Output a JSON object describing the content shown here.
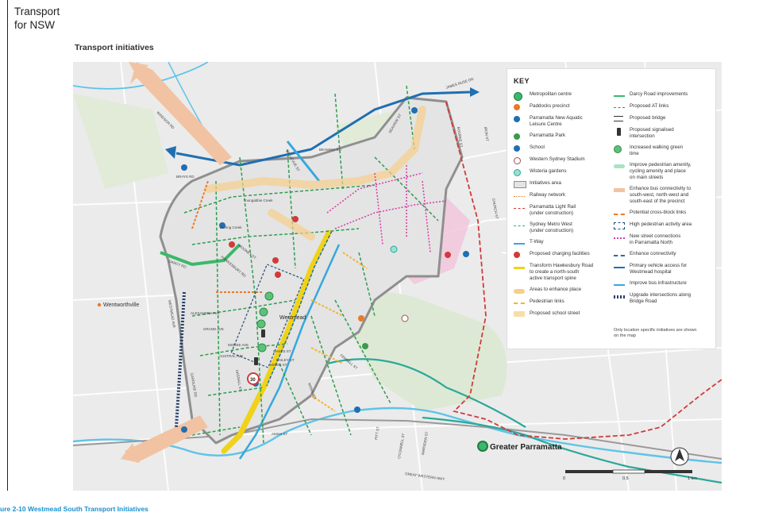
{
  "header": {
    "logo_text": "Transport\nfor NSW",
    "section_title": "Transport initiatives"
  },
  "caption": "ure 2-10 Westmead South Transport Initiatives",
  "map": {
    "places": {
      "westmead": "Westmead",
      "wentworthville": "Wentworthville",
      "greater_parramatta": "Greater Parramatta"
    },
    "speed_sign": "30",
    "streets": {
      "windsor_rd": "WINDSOR RD",
      "james_ruse_dr": "JAMES RUSE DR",
      "bourke_st": "BOURKE ST",
      "iron_st": "IRON ST",
      "brays_rd": "BRAYS RD",
      "church_st": "CHURCH ST",
      "bellevue_st": "BELLEVUE ST",
      "seaview_st": "SEAVIEW ST",
      "caroline_rd": "CAROLINE RD",
      "beamish_rd": "BEAMISH RD",
      "toongabbie_creek": "Toongabbie Creek",
      "darling_creek": "Darling Creek",
      "darcy_rd": "DARCY RD",
      "hawkesbury_rd": "HAWKESBURY RD",
      "westmead_ave": "WESTMEAD AVE",
      "alexandra_ave": "ALEXANDRA AVE",
      "grand_ave": "GRAND AVE",
      "moree_ave": "MOREE AVE",
      "austral_ave": "AUSTRAL AVE",
      "hassall_st": "HASSALL ST",
      "bailey_st": "BAILEY ST",
      "oakes_st": "OAKES ST",
      "moxie_st": "MOXIE ST",
      "amos_st": "AMOS ST",
      "pitt_st": "PITT ST",
      "oconnell_st": "O'CONNELL ST",
      "marsden_st": "MARSDEN ST",
      "great_western_hwy": "GREAT WESTERN HWY",
      "fennell_st": "FENNELL ST",
      "mons_rd": "MONS RD",
      "mooney_st": "MOONEY ST"
    },
    "scale_bar": {
      "ticks": [
        "0",
        "0.5",
        "1 km"
      ]
    },
    "colors": {
      "darcy_road": "#3bb86a",
      "at_links": "#2e9d4e",
      "light_rail": "#d23a3a",
      "metro": "#2aa89b",
      "tway": "#36a8dd",
      "hawkesbury_spine": "#f0d21a",
      "ped_links": "#f2b632",
      "place_areas": "#f7cf8b",
      "bus_connectivity": "#f2c3a2",
      "vehicle_access": "#1f6fb2",
      "new_street": "#d63aa7",
      "parramatta_north": "#f2c6dc",
      "initiatives_area_border": "#8f8f8f"
    }
  },
  "key": {
    "title": "KEY",
    "left": [
      {
        "label": "Metropolitan centre",
        "icon": "metropolitan-centre-icon"
      },
      {
        "label": "Paddocks precinct",
        "icon": "paddocks-icon"
      },
      {
        "label": "Parramatta New Aquatic\nLeisure Centre",
        "icon": "aquatic-centre-icon"
      },
      {
        "label": "Parramatta Park",
        "icon": "park-icon"
      },
      {
        "label": "School",
        "icon": "school-icon"
      },
      {
        "label": "Western Sydney Stadium",
        "icon": "stadium-icon"
      },
      {
        "label": "Wisteria gardens",
        "icon": "gardens-icon"
      },
      {
        "label": "Initiatives area",
        "icon": "initiatives-area-icon"
      },
      {
        "label": "Railway network",
        "icon": "railway-icon"
      },
      {
        "label": "Parramatta Light Rail\n(under construction)",
        "icon": "light-rail-icon"
      },
      {
        "label": "Sydney Metro West\n(under construction)",
        "icon": "metro-icon"
      },
      {
        "label": "T-Way",
        "icon": "tway-icon"
      },
      {
        "label": "Proposed charging facilities",
        "icon": "charging-icon"
      },
      {
        "label": "Transform Hawkesbury Road\nto create a north-south\nactive transport spine",
        "icon": "hawkesbury-spine-icon"
      },
      {
        "label": "Areas to enhance place",
        "icon": "enhance-place-icon"
      },
      {
        "label": "Pedestrian links",
        "icon": "pedestrian-links-icon"
      },
      {
        "label": "Proposed school street",
        "icon": "school-street-icon"
      }
    ],
    "right": [
      {
        "label": "Darcy Road improvements",
        "icon": "darcy-road-icon"
      },
      {
        "label": "Proposed AT links",
        "icon": "at-links-icon"
      },
      {
        "label": "Proposed bridge",
        "icon": "bridge-icon"
      },
      {
        "label": "Proposed signalised\nintersection",
        "icon": "signal-icon"
      },
      {
        "label": "Increased walking green\ntime",
        "icon": "walking-green-icon"
      },
      {
        "label": "Improve pedestrian amenity,\ncycling amenity and place\non main streets",
        "icon": "main-streets-icon"
      },
      {
        "label": "Enhance bus connectivity to\nsouth-west, north-west and\nsouth-east of the precinct",
        "icon": "bus-connectivity-icon"
      },
      {
        "label": "Potential cross-block links",
        "icon": "cross-block-icon"
      },
      {
        "label": "High pedestrian activity area",
        "icon": "high-ped-icon"
      },
      {
        "label": "New street connections\nin Parramatta North",
        "icon": "new-street-icon"
      },
      {
        "label": "Enhance connectivity",
        "icon": "enhance-connectivity-icon"
      },
      {
        "label": "Primary vehicle access for\nWestmead hospital",
        "icon": "vehicle-access-icon"
      },
      {
        "label": "Improve bus infrastructure",
        "icon": "bus-infra-icon"
      },
      {
        "label": "Upgrade intersections along\nBridge Road",
        "icon": "bridge-road-icon"
      }
    ],
    "note": "Only location specific initiatives are shown\non the map"
  }
}
